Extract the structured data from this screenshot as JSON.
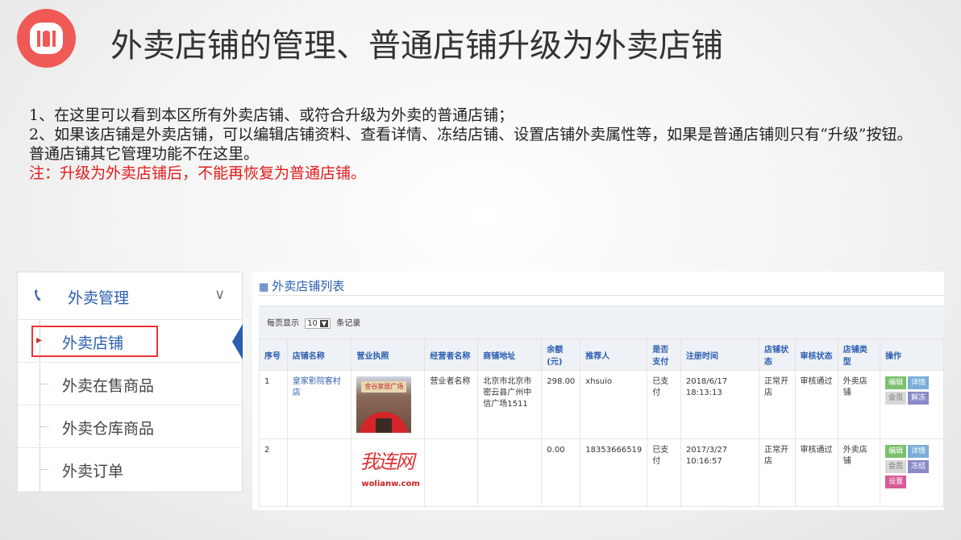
{
  "slide": {
    "title": "外卖店铺的管理、普通店铺升级为外卖店铺",
    "lines": [
      "1、在这里可以看到本区所有外卖店铺、或符合升级为外卖的普通店铺；",
      "2、如果该店铺是外卖店铺，可以编辑店铺资料、查看详情、冻结店铺、设置店铺外卖属性等，如果是普通店铺则只有“升级”按钮。普通店铺其它管理功能不在这里。"
    ],
    "note": "注：升级为外卖店铺后，不能再恢复为普通店铺。"
  },
  "sidebar": {
    "header_icon": "phone-icon",
    "header": "外卖管理",
    "items": [
      {
        "label": "外卖店铺",
        "active": true
      },
      {
        "label": "外卖在售商品"
      },
      {
        "label": "外卖仓库商品"
      },
      {
        "label": "外卖订单"
      }
    ]
  },
  "panel": {
    "title": "外卖店铺列表",
    "page_prefix": "每页显示",
    "page_size": "10",
    "page_suffix": "条记录",
    "columns": [
      "序号",
      "店铺名称",
      "营业执照",
      "经营者名称",
      "商铺地址",
      "余额(元)",
      "推荐人",
      "是否支付",
      "注册时间",
      "店铺状态",
      "审核状态",
      "店铺类型",
      "操作"
    ],
    "rows": [
      {
        "no": "1",
        "name": "皇家影院客村店",
        "license_sign": "金谷家居广场",
        "owner": "营业者名称",
        "address": "北京市北京市密云县广州中信广场1511",
        "balance": "298.00",
        "referrer": "xhsuio",
        "paid": "已支付",
        "reg_time": "2018/6/17 18:13:13",
        "status": "正常开店",
        "audit": "审核通过",
        "type": "外卖店铺",
        "ops": [
          "编辑",
          "详情",
          "会员",
          "解冻"
        ]
      },
      {
        "no": "2",
        "name": "",
        "license_logo": "我连网",
        "license_url": "wolianw.com",
        "owner": "",
        "address": "",
        "balance": "0.00",
        "referrer": "18353666519",
        "paid": "已支付",
        "reg_time": "2017/3/27 10:16:57",
        "status": "正常开店",
        "audit": "审核通过",
        "type": "外卖店铺",
        "ops": [
          "编辑",
          "详情",
          "会员",
          "冻结",
          "设置"
        ]
      }
    ]
  }
}
